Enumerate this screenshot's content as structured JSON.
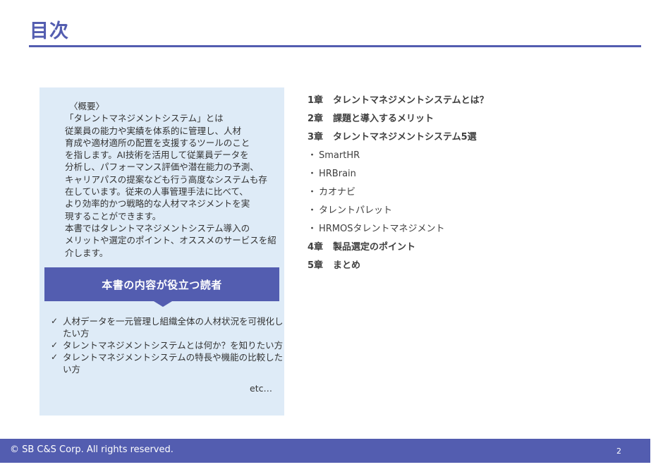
{
  "page": {
    "title": "目次",
    "page_number": "2",
    "colors": {
      "accent": "#535db0",
      "panel_background": "#deebf7",
      "text": "#333333"
    }
  },
  "overview": {
    "heading": "〈概要〉",
    "lines": [
      "「タレントマネジメントシステム」とは",
      "従業員の能力や実績を体系的に管理し、人材",
      "育成や適材適所の配置を支援するツールのこと",
      "を指します。AI技術を活用して従業員データを",
      "分析し、パフォーマンス評価や潜在能力の予測、",
      "キャリアパスの提案なども行う高度なシステムも存",
      "在しています。従来の人事管理手法に比べて、",
      "より効率的かつ戦略的な人材マネジメントを実",
      "現することができます。",
      "本書ではタレントマネジメントシステム導入の",
      "メリットや選定のポイント、オススメのサービスを紹",
      "介します。"
    ]
  },
  "readers": {
    "banner": "本書の内容が役立つ読者",
    "check_icon": "✓",
    "items": [
      "人材データを一元管理し組織全体の人材状況を可視化したい方",
      "タレントマネジメントシステムとは何か？を知りたい方",
      "タレントマネジメントシステムの特長や機能の比較したい方"
    ],
    "etc": "etc…"
  },
  "toc": {
    "bullet_icon": "・",
    "items": [
      {
        "num": "1章",
        "label": "タレントマネジメントシステムとは？"
      },
      {
        "num": "2章",
        "label": "課題と導入するメリット"
      },
      {
        "num": "3章",
        "label": "タレントマネジメントシステム5選"
      },
      {
        "label": "SmartHR"
      },
      {
        "label": "HRBrain"
      },
      {
        "label": "カオナビ"
      },
      {
        "label": "タレントパレット"
      },
      {
        "label": "HRMOSタレントマネジメント"
      },
      {
        "num": "4章",
        "label": "製品選定のポイント"
      },
      {
        "num": "5章",
        "label": "まとめ"
      }
    ]
  },
  "footer": {
    "copyright": "© SB C&S Corp. All rights reserved."
  }
}
